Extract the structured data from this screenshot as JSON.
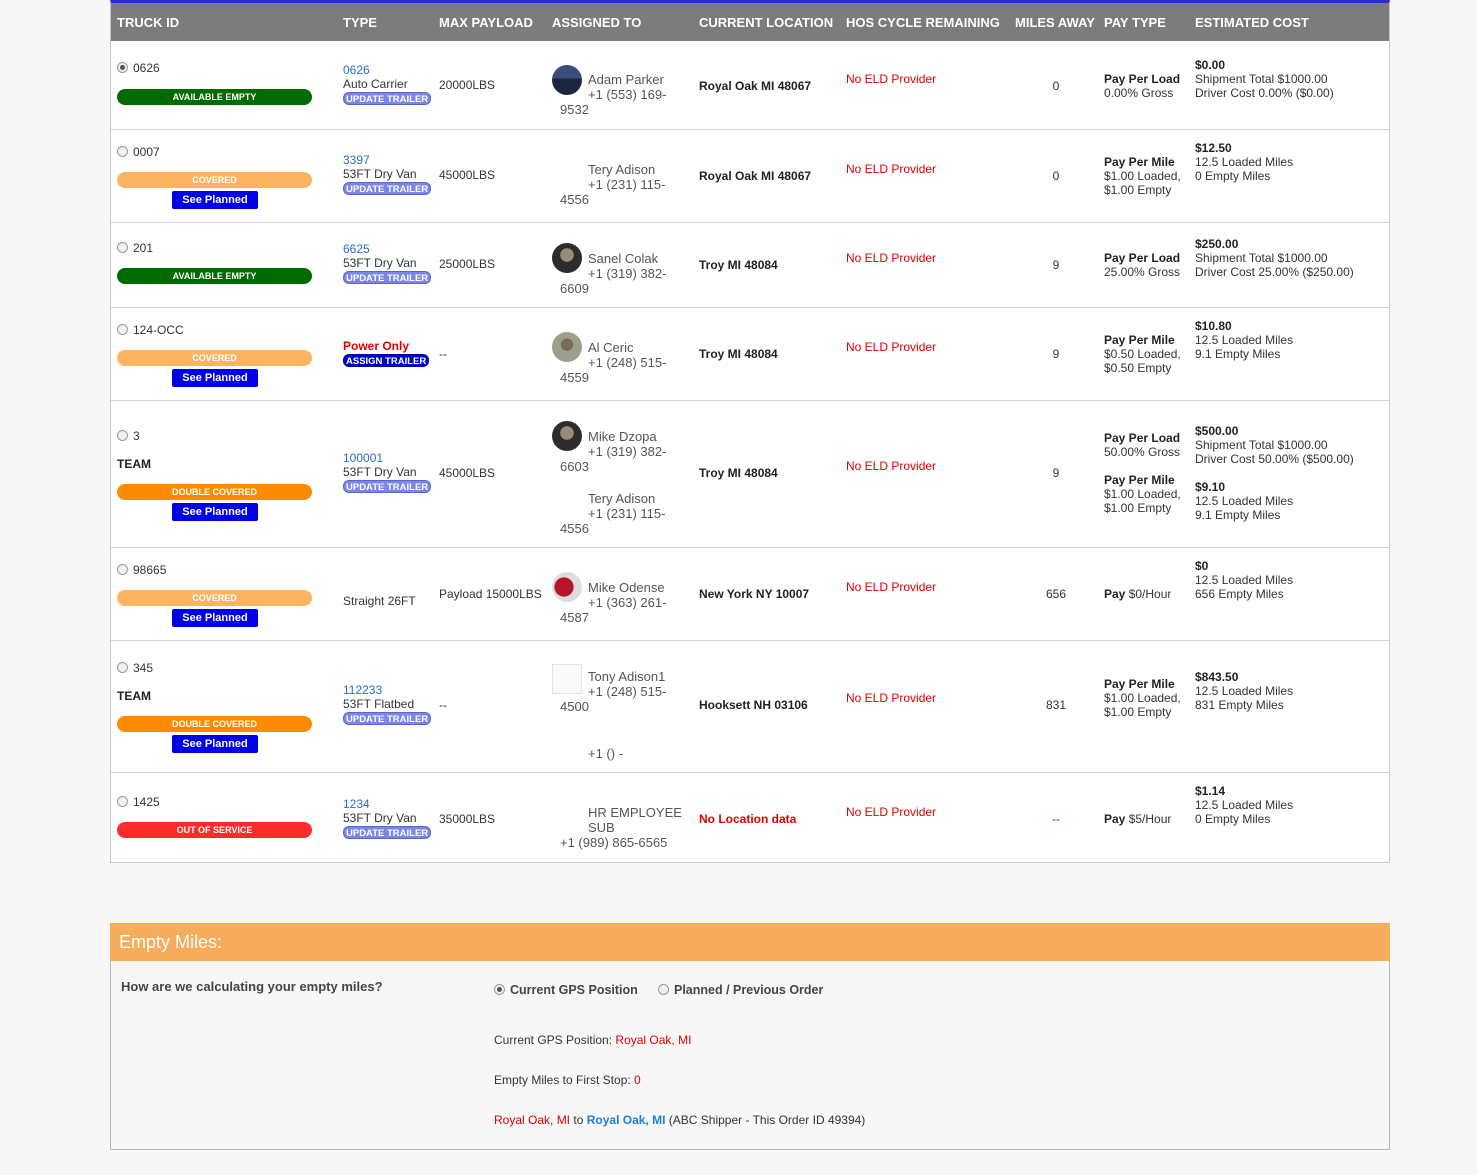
{
  "headers": {
    "truck_id": "TRUCK ID",
    "type": "TYPE",
    "max_payload": "MAX PAYLOAD",
    "assigned_to": "ASSIGNED TO",
    "current_location": "CURRENT LOCATION",
    "hos": "HOS CYCLE REMAINING",
    "miles_away": "MILES AWAY",
    "pay_type": "PAY TYPE",
    "estimated_cost": "ESTIMATED COST"
  },
  "rows": [
    {
      "truck_id": "0626",
      "selected": true,
      "status": "AVAILABLE EMPTY",
      "trailer_id": "0626",
      "trailer_type": "Auto Carrier",
      "trailer_button": "UPDATE TRAILER",
      "payload": "20000LBS",
      "driver1_name": "Adam Parker",
      "driver1_phone_a": "+1 (553) 169-",
      "driver1_phone_b": "9532",
      "location": "Royal Oak MI 48067",
      "eld": "No ELD Provider",
      "miles": "0",
      "pay1_type": "Pay Per Load",
      "pay1_detail": "0.00% Gross",
      "cost_total": "$0.00",
      "cost_line1": "Shipment Total $1000.00",
      "cost_line2": "Driver Cost 0.00% ($0.00)"
    },
    {
      "truck_id": "0007",
      "selected": false,
      "status": "COVERED",
      "see_planned": "See Planned",
      "trailer_id": "3397",
      "trailer_type": "53FT Dry Van",
      "trailer_button": "UPDATE TRAILER",
      "payload": "45000LBS",
      "driver1_name": "Tery Adison",
      "driver1_phone_a": "+1 (231) 115-",
      "driver1_phone_b": "4556",
      "location": "Royal Oak MI 48067",
      "eld": "No ELD Provider",
      "miles": "0",
      "pay1_type": "Pay Per Mile",
      "pay1_detail_a": "$1.00 Loaded,",
      "pay1_detail_b": "$1.00 Empty",
      "cost_total": "$12.50",
      "cost_line1": "12.5 Loaded Miles",
      "cost_line2": "0 Empty Miles"
    },
    {
      "truck_id": "201",
      "selected": false,
      "status": "AVAILABLE EMPTY",
      "trailer_id": "6625",
      "trailer_type": "53FT Dry Van",
      "trailer_button": "UPDATE TRAILER",
      "payload": "25000LBS",
      "driver1_name": "Sanel Colak",
      "driver1_phone_a": "+1 (319) 382-",
      "driver1_phone_b": "6609",
      "location": "Troy MI 48084",
      "eld": "No ELD Provider",
      "miles": "9",
      "pay1_type": "Pay Per Load",
      "pay1_detail": "25.00% Gross",
      "cost_total": "$250.00",
      "cost_line1": "Shipment Total $1000.00",
      "cost_line2": "Driver Cost 25.00% ($250.00)"
    },
    {
      "truck_id": "124-OCC",
      "selected": false,
      "status": "COVERED",
      "see_planned": "See Planned",
      "trailer_type_red": "Power Only",
      "trailer_button": "ASSIGN TRAILER",
      "payload": "--",
      "driver1_name": "Al Ceric",
      "driver1_phone_a": "+1 (248) 515-",
      "driver1_phone_b": "4559",
      "location": "Troy MI 48084",
      "eld": "No ELD Provider",
      "miles": "9",
      "pay1_type": "Pay Per Mile",
      "pay1_detail_a": "$0.50 Loaded,",
      "pay1_detail_b": "$0.50 Empty",
      "cost_total": "$10.80",
      "cost_line1": "12.5 Loaded Miles",
      "cost_line2": "9.1 Empty Miles"
    },
    {
      "truck_id": "3",
      "selected": false,
      "team": "TEAM",
      "status": "DOUBLE COVERED",
      "see_planned": "See Planned",
      "trailer_id": "100001",
      "trailer_type": "53FT Dry Van",
      "trailer_button": "UPDATE TRAILER",
      "payload": "45000LBS",
      "driver1_name": "Mike Dzopa",
      "driver1_phone_a": "+1 (319) 382-",
      "driver1_phone_b": "6603",
      "driver2_name": "Tery Adison",
      "driver2_phone_a": "+1 (231) 115-",
      "driver2_phone_b": "4556",
      "location": "Troy MI 48084",
      "eld": "No ELD Provider",
      "miles": "9",
      "pay1_type": "Pay Per Load",
      "pay1_detail": "50.00% Gross",
      "pay2_type": "Pay Per Mile",
      "pay2_detail_a": "$1.00 Loaded,",
      "pay2_detail_b": "$1.00 Empty",
      "cost_total": "$500.00",
      "cost_line1": "Shipment Total $1000.00",
      "cost_line2": "Driver Cost 50.00% ($500.00)",
      "cost2_total": "$9.10",
      "cost2_line1": "12.5 Loaded Miles",
      "cost2_line2": "9.1 Empty Miles"
    },
    {
      "truck_id": "98665",
      "selected": false,
      "status": "COVERED",
      "see_planned": "See Planned",
      "trailer_type": "Straight 26FT",
      "payload": "Payload 15000LBS",
      "driver1_name": "Mike Odense",
      "driver1_phone_a": "+1 (363) 261-",
      "driver1_phone_b": "4587",
      "location": "New York NY 10007",
      "eld": "No ELD Provider",
      "miles": "656",
      "pay1_type": "Pay",
      "pay1_detail": "$0/Hour",
      "cost_total": "$0",
      "cost_line1": "12.5 Loaded Miles",
      "cost_line2": "656 Empty Miles"
    },
    {
      "truck_id": "345",
      "selected": false,
      "team": "TEAM",
      "status": "DOUBLE COVERED",
      "see_planned": "See Planned",
      "trailer_id": "112233",
      "trailer_type": "53FT Flatbed",
      "trailer_button": "UPDATE TRAILER",
      "payload": "--",
      "driver1_name": "Tony Adison1",
      "driver1_phone_a": "+1 (248) 515-",
      "driver1_phone_b": "4500",
      "driver2_phone_a": "+1 () -",
      "location": "Hooksett NH 03106",
      "eld": "No ELD Provider",
      "miles": "831",
      "pay1_type": "Pay Per Mile",
      "pay1_detail_a": "$1.00 Loaded,",
      "pay1_detail_b": "$1.00 Empty",
      "cost_total": "$843.50",
      "cost_line1": "12.5 Loaded Miles",
      "cost_line2": "831 Empty Miles"
    },
    {
      "truck_id": "1425",
      "selected": false,
      "status": "OUT OF SERVICE",
      "trailer_id": "1234",
      "trailer_type": "53FT Dry Van",
      "trailer_button": "UPDATE TRAILER",
      "payload": "35000LBS",
      "driver1_name": "HR EMPLOYEE",
      "driver1_name_b": "SUB",
      "driver1_phone_a": "+1 (989) 865-6565",
      "location": "No Location data",
      "eld": "No ELD Provider",
      "miles": "--",
      "pay1_type": "Pay",
      "pay1_detail": "$5/Hour",
      "cost_total": "$1.14",
      "cost_line1": "12.5 Loaded Miles",
      "cost_line2": "0 Empty Miles"
    }
  ],
  "empty_miles": {
    "title": "Empty Miles:",
    "question": "How are we calculating your empty miles?",
    "option_gps": "Current GPS Position",
    "option_planned": "Planned / Previous Order",
    "gps_label": "Current GPS Position:",
    "gps_value": "Royal Oak, MI",
    "first_stop_label": "Empty Miles to First Stop:",
    "first_stop_value": "0",
    "route_from": "Royal Oak, MI",
    "route_to_word": "to",
    "route_to": "Royal Oak, MI",
    "route_note": "(ABC Shipper - This Order ID 49394)"
  },
  "colors": {
    "header_bg": "#7c7c7c",
    "accent_top": "#2a2ad6",
    "available": "#006b00",
    "covered": "#fcb462",
    "double_covered": "#fb8c00",
    "out_of_service": "#ff2a2a",
    "see_planned": "#0000e6",
    "empty_miles_header": "#f5ad5b"
  }
}
